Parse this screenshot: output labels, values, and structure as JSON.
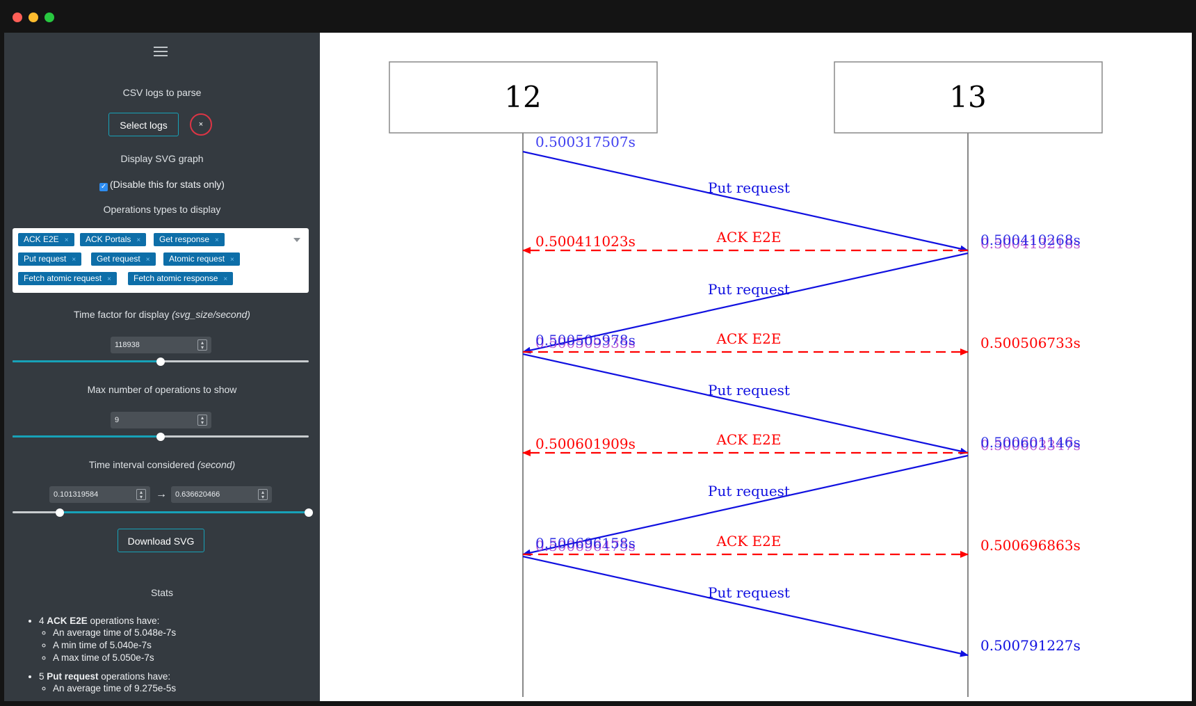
{
  "window": {
    "buttons": [
      "close",
      "minimize",
      "maximize"
    ]
  },
  "sidebar": {
    "menu_icon": "hamburger-icon",
    "csv_label": "CSV logs to parse",
    "select_logs": "Select logs",
    "clear_label": "×",
    "svg_label": "Display SVG graph",
    "svg_checkbox": {
      "checked": true,
      "label": "(Disable this for stats only)"
    },
    "ops_label": "Operations types to display",
    "op_tags": [
      "ACK E2E",
      "ACK Portals",
      "Get response",
      "Put request",
      "Get request",
      "Atomic request",
      "Fetch atomic request",
      "Fetch atomic response"
    ],
    "tag_remove": "×",
    "time_factor": {
      "label": "Time factor for display ",
      "unit": "(svg_size/second)",
      "value": "118938",
      "slider_fraction": 0.5
    },
    "max_ops": {
      "label": "Max number of operations to show",
      "value": "9",
      "slider_fraction": 0.5
    },
    "interval": {
      "label": "Time interval considered ",
      "unit": "(second)",
      "from": "0.101319584",
      "to": "0.636620466",
      "arrow": "→",
      "low_fraction": 0.16,
      "high_fraction": 1.0
    },
    "download_svg": "Download SVG",
    "stats": {
      "title": "Stats",
      "groups": [
        {
          "prefix": "4 ",
          "op": "ACK E2E",
          "suffix": " operations have:",
          "items": [
            "An average time of 5.048e-7s",
            "A min time of 5.040e-7s",
            "A max time of 5.050e-7s"
          ]
        },
        {
          "prefix": "5 ",
          "op": "Put request",
          "suffix": " operations have:",
          "items": [
            "An average time of 9.275e-5s"
          ]
        }
      ]
    }
  },
  "diagram": {
    "colors": {
      "put": "#1010e0",
      "ack": "#ff0000",
      "put_time": "#4040f0",
      "lifeline": "#888888"
    },
    "nodes": [
      "12",
      "13"
    ],
    "labels": {
      "put": [
        "Put request",
        "Put request",
        "Put request",
        "Put request",
        "Put request"
      ],
      "ack": [
        "ACK E2E",
        "ACK E2E",
        "ACK E2E",
        "ACK E2E"
      ]
    },
    "timestamps": {
      "t1": "0.500317507s",
      "t2": "0.500410268s",
      "t2b": "0.500413218s",
      "t3": "0.500411023s",
      "t4": "0.500505978s",
      "t4b": "0.500509335s",
      "t5": "0.500506733s",
      "t6": "0.500601146s",
      "t6b": "0.500603347s",
      "t7": "0.500601909s",
      "t8": "0.500696158s",
      "t8b": "0.500696475s",
      "t9": "0.500696863s",
      "t10": "0.500791227s"
    }
  }
}
